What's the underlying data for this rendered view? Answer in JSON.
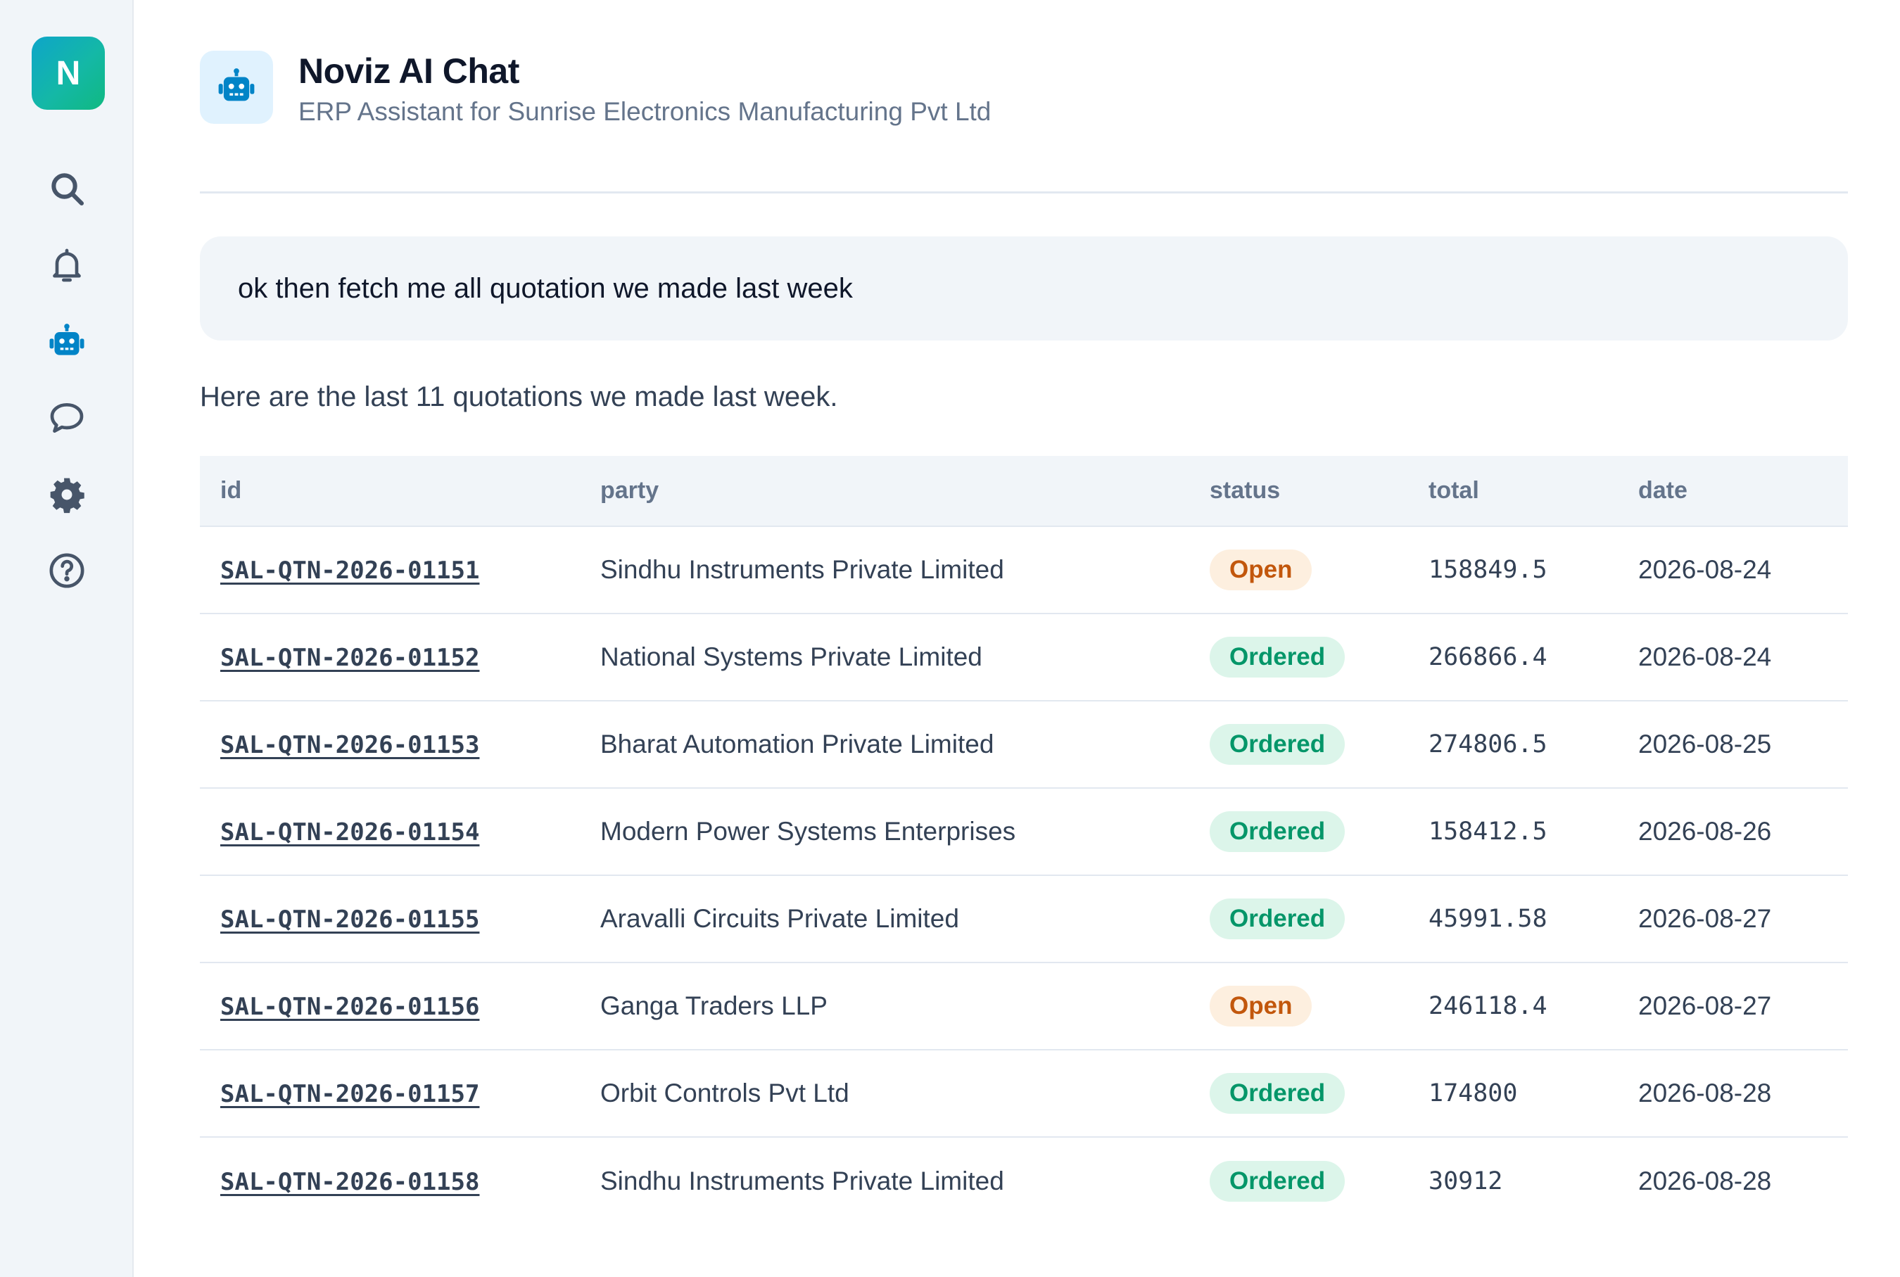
{
  "sidebar": {
    "logo_letter": "N",
    "items": [
      {
        "name": "search",
        "icon": "search-icon",
        "active": false
      },
      {
        "name": "notifications",
        "icon": "bell-icon",
        "active": false
      },
      {
        "name": "ai-chat",
        "icon": "robot-icon",
        "active": true
      },
      {
        "name": "messages",
        "icon": "chat-bubble-icon",
        "active": false
      },
      {
        "name": "settings",
        "icon": "gear-icon",
        "active": false
      },
      {
        "name": "help",
        "icon": "help-circle-icon",
        "active": false
      }
    ]
  },
  "header": {
    "title": "Noviz AI Chat",
    "subtitle": "ERP Assistant for Sunrise Electronics Manufacturing Pvt Ltd",
    "avatar_icon": "robot-icon"
  },
  "chat": {
    "user_message": "ok then fetch me all quotation we made last week",
    "assistant_message": "Here are the last 11 quotations we made last week."
  },
  "table": {
    "columns": [
      "id",
      "party",
      "status",
      "total",
      "date"
    ],
    "rows": [
      {
        "id": "SAL-QTN-2026-01151",
        "party": "Sindhu Instruments Private Limited",
        "status": "Open",
        "total": "158849.5",
        "date": "2026-08-24"
      },
      {
        "id": "SAL-QTN-2026-01152",
        "party": "National Systems Private Limited",
        "status": "Ordered",
        "total": "266866.4",
        "date": "2026-08-24"
      },
      {
        "id": "SAL-QTN-2026-01153",
        "party": "Bharat Automation Private Limited",
        "status": "Ordered",
        "total": "274806.5",
        "date": "2026-08-25"
      },
      {
        "id": "SAL-QTN-2026-01154",
        "party": "Modern Power Systems Enterprises",
        "status": "Ordered",
        "total": "158412.5",
        "date": "2026-08-26"
      },
      {
        "id": "SAL-QTN-2026-01155",
        "party": "Aravalli Circuits Private Limited",
        "status": "Ordered",
        "total": "45991.58",
        "date": "2026-08-27"
      },
      {
        "id": "SAL-QTN-2026-01156",
        "party": "Ganga Traders LLP",
        "status": "Open",
        "total": "246118.4",
        "date": "2026-08-27"
      },
      {
        "id": "SAL-QTN-2026-01157",
        "party": "Orbit Controls Pvt Ltd",
        "status": "Ordered",
        "total": "174800",
        "date": "2026-08-28"
      },
      {
        "id": "SAL-QTN-2026-01158",
        "party": "Sindhu Instruments Private Limited",
        "status": "Ordered",
        "total": "30912",
        "date": "2026-08-28"
      }
    ]
  },
  "colors": {
    "accent": "#0284c7",
    "icon_muted": "#64748b",
    "status_open_bg": "#fdefdf",
    "status_open_fg": "#c2570c",
    "status_ordered_bg": "#dcf5ea",
    "status_ordered_fg": "#059669"
  }
}
